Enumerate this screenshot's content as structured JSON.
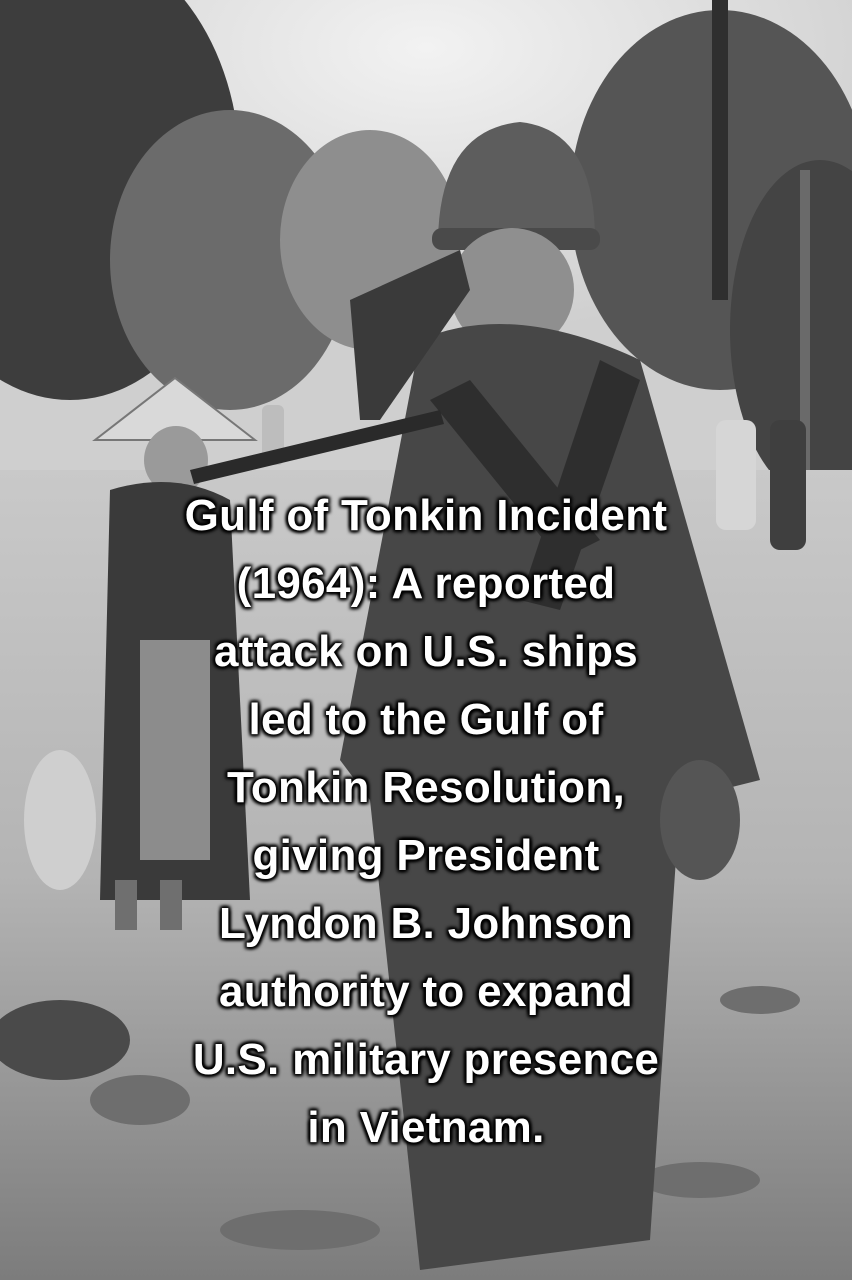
{
  "photo": {
    "subject": "black-and-white photograph: soldier with helmet and ammunition belts walking on a dirt road, woman in conical hat walking behind",
    "tone": "grayscale"
  },
  "caption": {
    "lines": [
      "Gulf of Tonkin Incident",
      "(1964): A reported",
      "attack on U.S. ships",
      "led to the Gulf of",
      "Tonkin Resolution,",
      "giving President",
      "Lyndon B. Johnson",
      "authority to expand",
      "U.S. military presence",
      "in Vietnam."
    ]
  }
}
